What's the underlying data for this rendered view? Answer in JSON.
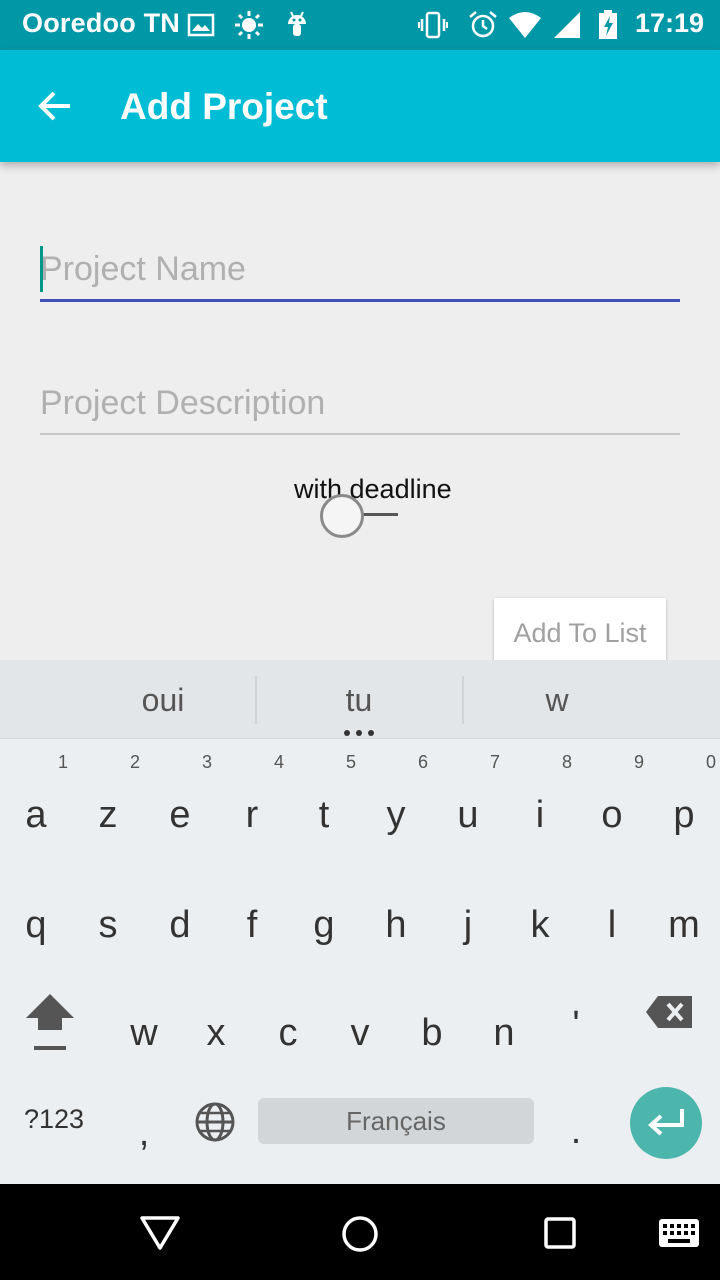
{
  "status_bar": {
    "carrier": "Ooredoo TN",
    "time": "17:19"
  },
  "toolbar": {
    "title": "Add Project"
  },
  "form": {
    "name_placeholder": "Project Name",
    "description_placeholder": "Project Description",
    "deadline_label": "with deadline",
    "add_button": "Add To List"
  },
  "keyboard": {
    "suggestions": [
      "oui",
      "tu",
      "w"
    ],
    "row1": [
      {
        "key": "a",
        "hint": "1"
      },
      {
        "key": "z",
        "hint": "2"
      },
      {
        "key": "e",
        "hint": "3"
      },
      {
        "key": "r",
        "hint": "4"
      },
      {
        "key": "t",
        "hint": "5"
      },
      {
        "key": "y",
        "hint": "6"
      },
      {
        "key": "u",
        "hint": "7"
      },
      {
        "key": "i",
        "hint": "8"
      },
      {
        "key": "o",
        "hint": "9"
      },
      {
        "key": "p",
        "hint": "0"
      }
    ],
    "row2": [
      "q",
      "s",
      "d",
      "f",
      "g",
      "h",
      "j",
      "k",
      "l",
      "m"
    ],
    "row3": [
      "w",
      "x",
      "c",
      "v",
      "b",
      "n",
      "'"
    ],
    "symbols_label": "?123",
    "comma": ",",
    "space_label": "Français",
    "period": "."
  },
  "colors": {
    "status_bar": "#0097a7",
    "toolbar": "#00bcd4",
    "accent": "#3f51b5",
    "enter": "#4db6ac"
  }
}
